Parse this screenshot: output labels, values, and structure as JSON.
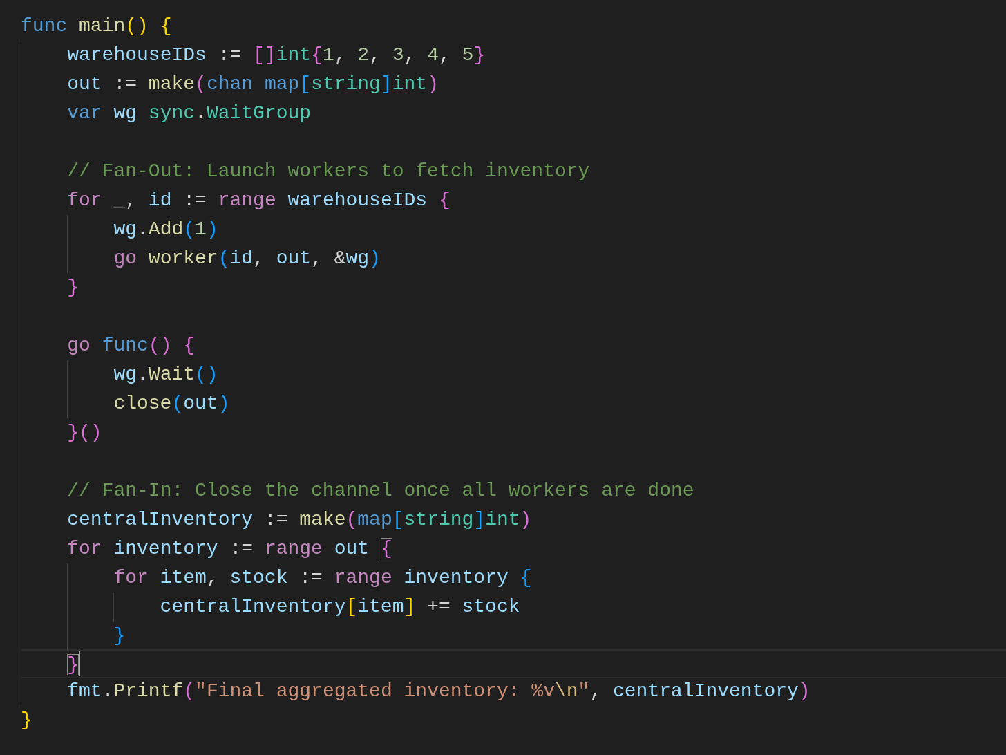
{
  "editor": {
    "lines": [
      {
        "kind": "code",
        "current": false,
        "tokens": [
          {
            "text": "func ",
            "kind": "kw"
          },
          {
            "text": "main",
            "kind": "fn"
          },
          {
            "text": "() ",
            "kind": "br1"
          },
          {
            "text": "{",
            "kind": "br1"
          }
        ]
      },
      {
        "kind": "code",
        "current": false,
        "tokens": [
          {
            "text": "    warehouseIDs",
            "kind": "var"
          },
          {
            "text": " := ",
            "kind": "op"
          },
          {
            "text": "[]",
            "kind": "br2"
          },
          {
            "text": "int",
            "kind": "type"
          },
          {
            "text": "{",
            "kind": "br2"
          },
          {
            "text": "1",
            "kind": "num"
          },
          {
            "text": ", ",
            "kind": "op"
          },
          {
            "text": "2",
            "kind": "num"
          },
          {
            "text": ", ",
            "kind": "op"
          },
          {
            "text": "3",
            "kind": "num"
          },
          {
            "text": ", ",
            "kind": "op"
          },
          {
            "text": "4",
            "kind": "num"
          },
          {
            "text": ", ",
            "kind": "op"
          },
          {
            "text": "5",
            "kind": "num"
          },
          {
            "text": "}",
            "kind": "br2"
          }
        ]
      },
      {
        "kind": "code",
        "current": false,
        "tokens": [
          {
            "text": "    out",
            "kind": "var"
          },
          {
            "text": " := ",
            "kind": "op"
          },
          {
            "text": "make",
            "kind": "fn"
          },
          {
            "text": "(",
            "kind": "br2"
          },
          {
            "text": "chan map",
            "kind": "kw"
          },
          {
            "text": "[",
            "kind": "br3"
          },
          {
            "text": "string",
            "kind": "type"
          },
          {
            "text": "]",
            "kind": "br3"
          },
          {
            "text": "int",
            "kind": "type"
          },
          {
            "text": ")",
            "kind": "br2"
          }
        ]
      },
      {
        "kind": "code",
        "current": false,
        "tokens": [
          {
            "text": "    var ",
            "kind": "kw"
          },
          {
            "text": "wg ",
            "kind": "var"
          },
          {
            "text": "sync",
            "kind": "type"
          },
          {
            "text": ".",
            "kind": "op"
          },
          {
            "text": "WaitGroup",
            "kind": "type"
          }
        ]
      },
      {
        "kind": "blank",
        "current": false
      },
      {
        "kind": "code",
        "current": false,
        "tokens": [
          {
            "text": "    // Fan-Out: Launch workers to fetch inventory",
            "kind": "comment"
          }
        ]
      },
      {
        "kind": "code",
        "current": false,
        "tokens": [
          {
            "text": "    for",
            "kind": "ctrl"
          },
          {
            "text": " _, ",
            "kind": "op"
          },
          {
            "text": "id",
            "kind": "var"
          },
          {
            "text": " := ",
            "kind": "op"
          },
          {
            "text": "range ",
            "kind": "ctrl"
          },
          {
            "text": "warehouseIDs ",
            "kind": "var"
          },
          {
            "text": "{",
            "kind": "br2"
          }
        ]
      },
      {
        "kind": "code",
        "current": false,
        "tokens": [
          {
            "text": "        wg",
            "kind": "var"
          },
          {
            "text": ".",
            "kind": "op"
          },
          {
            "text": "Add",
            "kind": "fn"
          },
          {
            "text": "(",
            "kind": "br3"
          },
          {
            "text": "1",
            "kind": "num"
          },
          {
            "text": ")",
            "kind": "br3"
          }
        ]
      },
      {
        "kind": "code",
        "current": false,
        "tokens": [
          {
            "text": "        go ",
            "kind": "ctrl"
          },
          {
            "text": "worker",
            "kind": "fn"
          },
          {
            "text": "(",
            "kind": "br3"
          },
          {
            "text": "id",
            "kind": "var"
          },
          {
            "text": ", ",
            "kind": "op"
          },
          {
            "text": "out",
            "kind": "var"
          },
          {
            "text": ", &",
            "kind": "op"
          },
          {
            "text": "wg",
            "kind": "var"
          },
          {
            "text": ")",
            "kind": "br3"
          }
        ]
      },
      {
        "kind": "code",
        "current": false,
        "tokens": [
          {
            "text": "    }",
            "kind": "br2"
          }
        ]
      },
      {
        "kind": "blank",
        "current": false
      },
      {
        "kind": "code",
        "current": false,
        "tokens": [
          {
            "text": "    go ",
            "kind": "ctrl"
          },
          {
            "text": "func",
            "kind": "kw"
          },
          {
            "text": "() {",
            "kind": "br2"
          }
        ]
      },
      {
        "kind": "code",
        "current": false,
        "tokens": [
          {
            "text": "        wg",
            "kind": "var"
          },
          {
            "text": ".",
            "kind": "op"
          },
          {
            "text": "Wait",
            "kind": "fn"
          },
          {
            "text": "()",
            "kind": "br3"
          }
        ]
      },
      {
        "kind": "code",
        "current": false,
        "tokens": [
          {
            "text": "        close",
            "kind": "fn"
          },
          {
            "text": "(",
            "kind": "br3"
          },
          {
            "text": "out",
            "kind": "var"
          },
          {
            "text": ")",
            "kind": "br3"
          }
        ]
      },
      {
        "kind": "code",
        "current": false,
        "tokens": [
          {
            "text": "    }()",
            "kind": "br2"
          }
        ]
      },
      {
        "kind": "blank",
        "current": false
      },
      {
        "kind": "code",
        "current": false,
        "tokens": [
          {
            "text": "    // Fan-In: Close the channel once all workers are done",
            "kind": "comment"
          }
        ]
      },
      {
        "kind": "code",
        "current": false,
        "tokens": [
          {
            "text": "    centralInventory",
            "kind": "var"
          },
          {
            "text": " := ",
            "kind": "op"
          },
          {
            "text": "make",
            "kind": "fn"
          },
          {
            "text": "(",
            "kind": "br2"
          },
          {
            "text": "map",
            "kind": "kw"
          },
          {
            "text": "[",
            "kind": "br3"
          },
          {
            "text": "string",
            "kind": "type"
          },
          {
            "text": "]",
            "kind": "br3"
          },
          {
            "text": "int",
            "kind": "type"
          },
          {
            "text": ")",
            "kind": "br2"
          }
        ]
      },
      {
        "kind": "code",
        "current": false,
        "tokens": [
          {
            "text": "    for ",
            "kind": "ctrl"
          },
          {
            "text": "inventory",
            "kind": "var"
          },
          {
            "text": " := ",
            "kind": "op"
          },
          {
            "text": "range ",
            "kind": "ctrl"
          },
          {
            "text": "out ",
            "kind": "var"
          },
          {
            "text": "{",
            "kind": "matched"
          }
        ]
      },
      {
        "kind": "code",
        "current": false,
        "tokens": [
          {
            "text": "        for ",
            "kind": "ctrl"
          },
          {
            "text": "item",
            "kind": "var"
          },
          {
            "text": ", ",
            "kind": "op"
          },
          {
            "text": "stock",
            "kind": "var"
          },
          {
            "text": " := ",
            "kind": "op"
          },
          {
            "text": "range ",
            "kind": "ctrl"
          },
          {
            "text": "inventory ",
            "kind": "var"
          },
          {
            "text": "{",
            "kind": "br3"
          }
        ]
      },
      {
        "kind": "code",
        "current": false,
        "tokens": [
          {
            "text": "            centralInventory",
            "kind": "var"
          },
          {
            "text": "[",
            "kind": "br1"
          },
          {
            "text": "item",
            "kind": "var"
          },
          {
            "text": "]",
            "kind": "br1"
          },
          {
            "text": " += ",
            "kind": "op"
          },
          {
            "text": "stock",
            "kind": "var"
          }
        ]
      },
      {
        "kind": "code",
        "current": false,
        "tokens": [
          {
            "text": "        }",
            "kind": "br3"
          }
        ]
      },
      {
        "kind": "code",
        "current": true,
        "tokens": [
          {
            "text": "    }",
            "kind": "matched"
          }
        ]
      },
      {
        "kind": "code",
        "current": false,
        "tokens": [
          {
            "text": "    fmt",
            "kind": "var"
          },
          {
            "text": ".",
            "kind": "op"
          },
          {
            "text": "Printf",
            "kind": "fn"
          },
          {
            "text": "(",
            "kind": "br2"
          },
          {
            "text": "\"Final aggregated inventory: %v",
            "kind": "str"
          },
          {
            "text": "\\n",
            "kind": "esc"
          },
          {
            "text": "\"",
            "kind": "str"
          },
          {
            "text": ", ",
            "kind": "op"
          },
          {
            "text": "centralInventory",
            "kind": "var"
          },
          {
            "text": ")",
            "kind": "br2"
          }
        ]
      },
      {
        "kind": "code",
        "current": false,
        "tokens": [
          {
            "text": "}",
            "kind": "br1"
          }
        ]
      }
    ]
  }
}
